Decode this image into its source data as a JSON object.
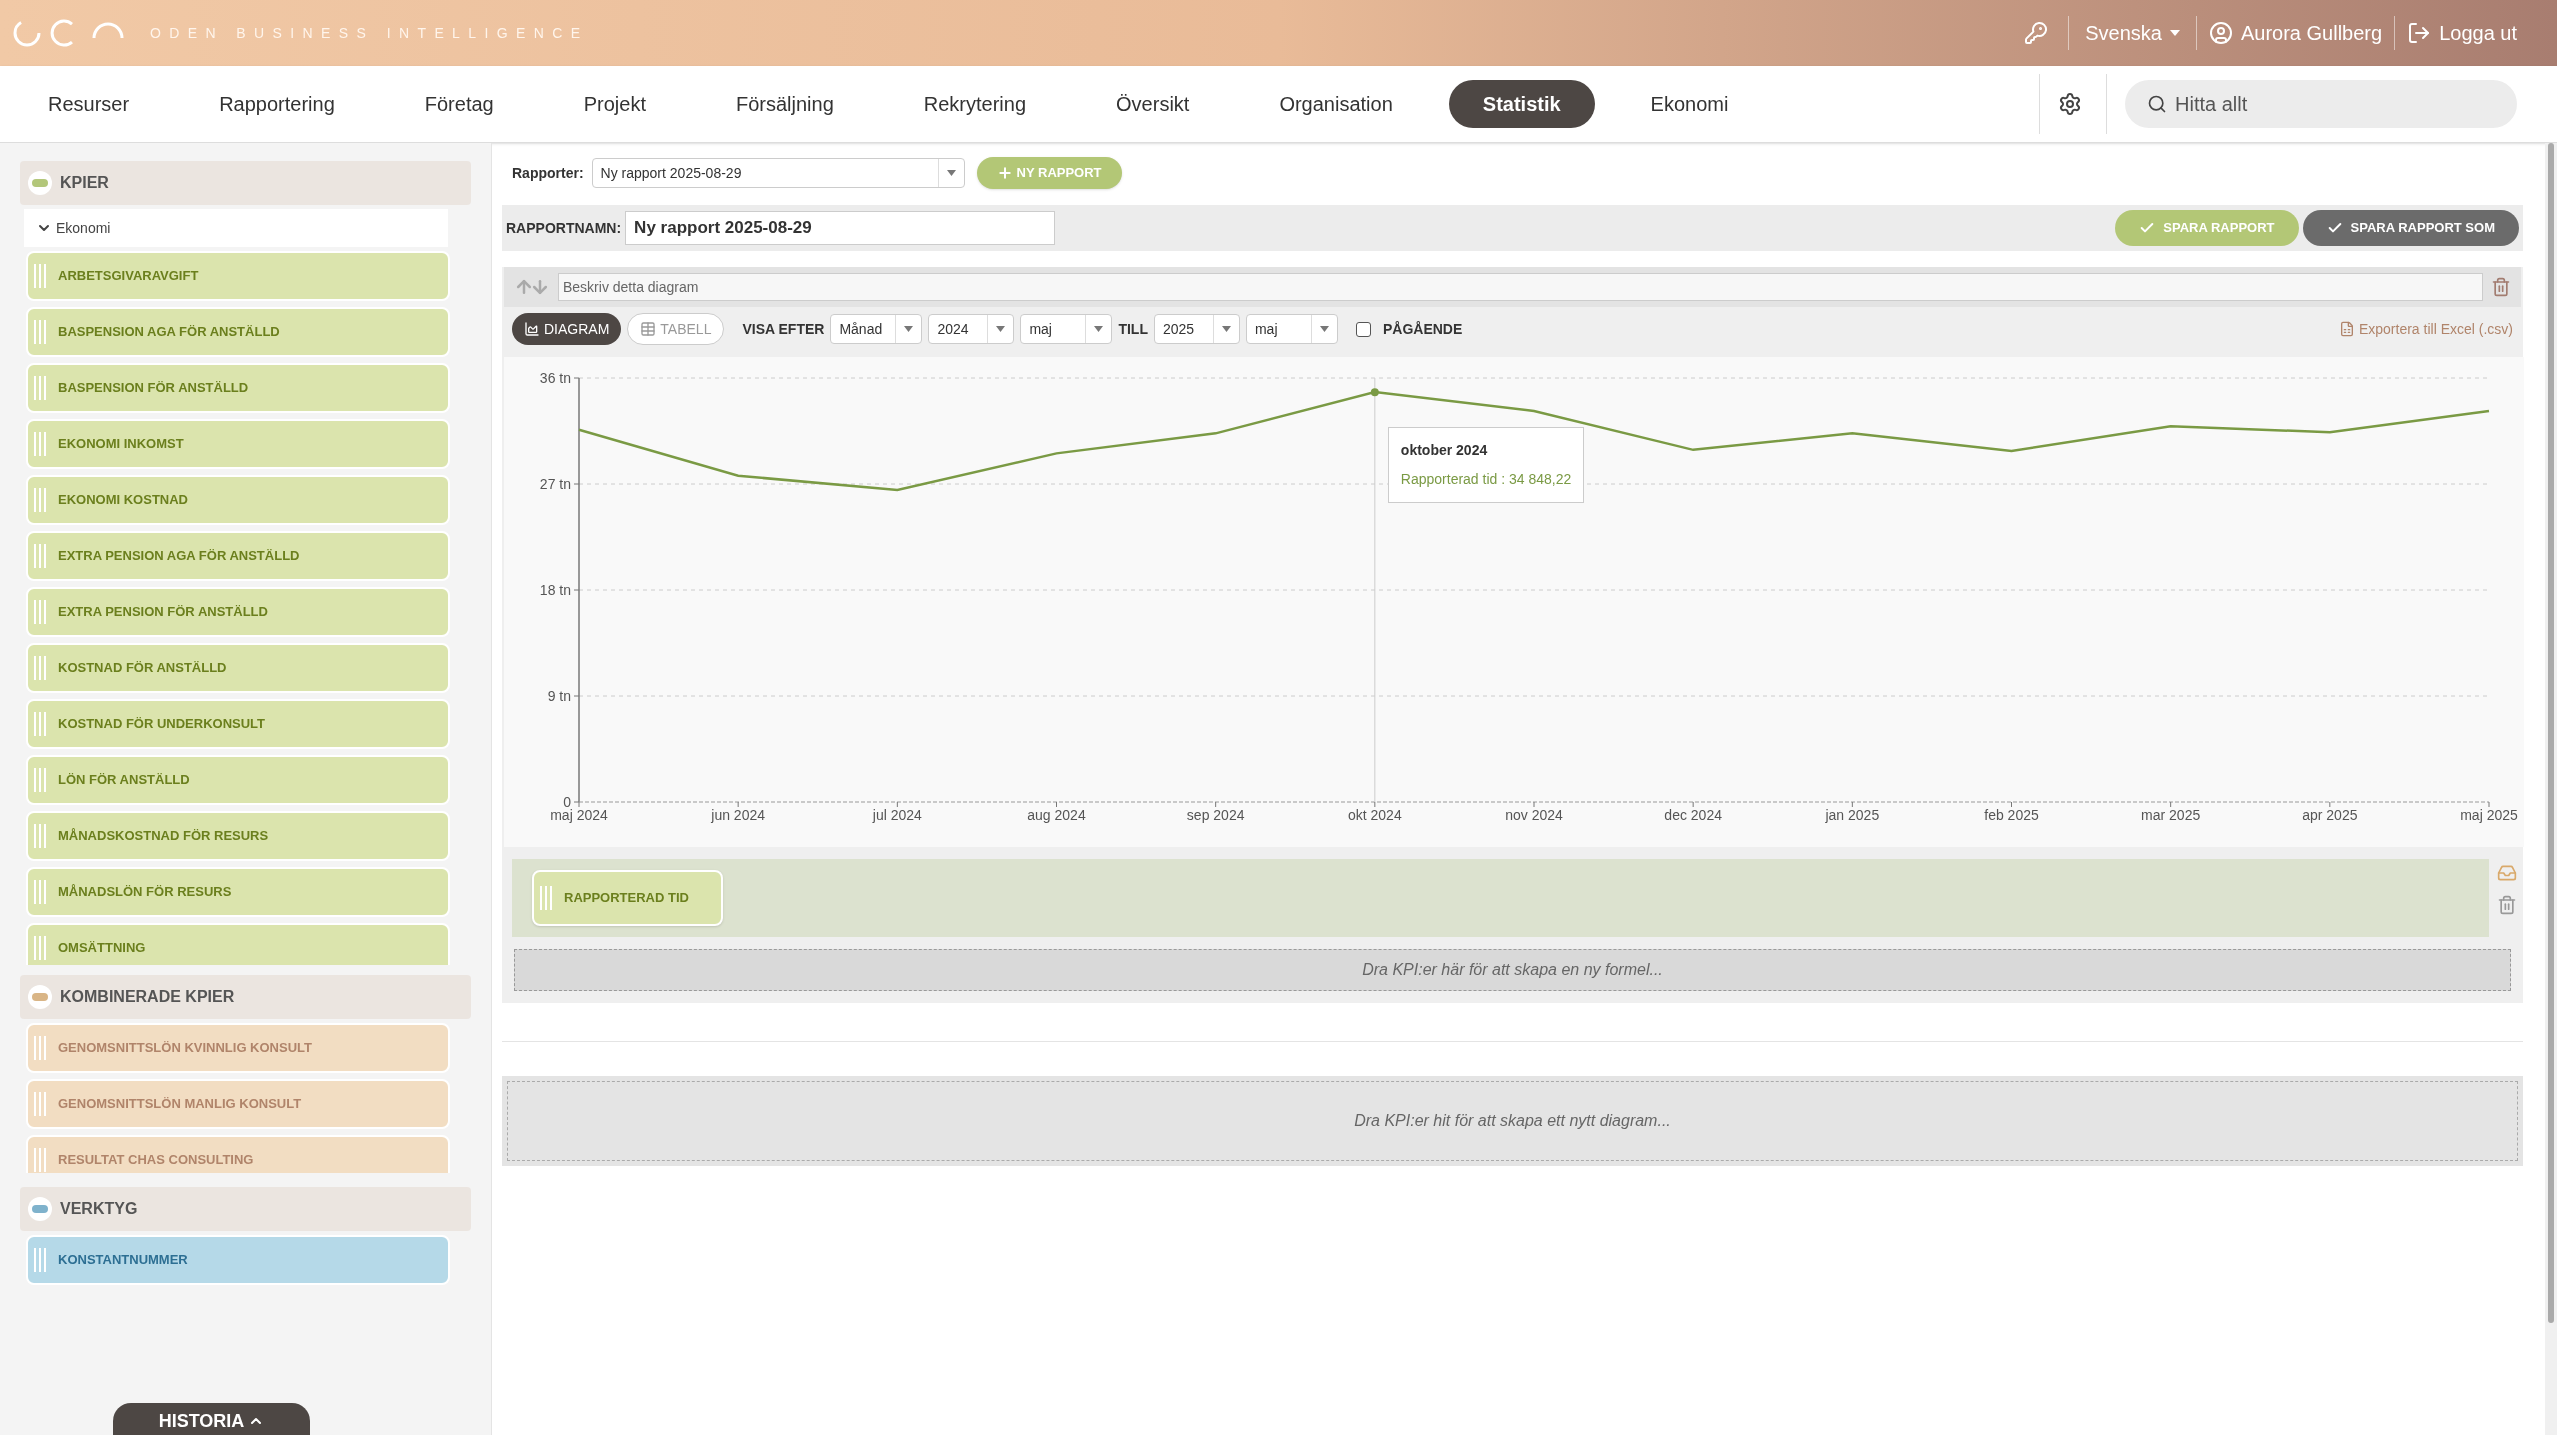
{
  "header": {
    "brand": "ODEN BUSINESS INTELLIGENCE",
    "language": "Svenska",
    "user": "Aurora Gullberg",
    "logout": "Logga ut"
  },
  "nav": {
    "items": [
      {
        "label": "Resurser",
        "selected": false
      },
      {
        "label": "Rapportering",
        "selected": false
      },
      {
        "label": "Företag",
        "selected": false
      },
      {
        "label": "Projekt",
        "selected": false
      },
      {
        "label": "Försäljning",
        "selected": false
      },
      {
        "label": "Rekrytering",
        "selected": false
      },
      {
        "label": "Översikt",
        "selected": false
      },
      {
        "label": "Organisation",
        "selected": false
      },
      {
        "label": "Statistik",
        "selected": true
      },
      {
        "label": "Ekonomi",
        "selected": false
      }
    ],
    "search": {
      "placeholder": "Hitta allt"
    }
  },
  "sidebar": {
    "sections": [
      {
        "title": "KPIER",
        "kind": "kpi",
        "group": {
          "label": "Ekonomi",
          "expanded": true
        },
        "items": [
          "ARBETSGIVARAVGIFT",
          "BASPENSION AGA FÖR ANSTÄLLD",
          "BASPENSION FÖR ANSTÄLLD",
          "EKONOMI INKOMST",
          "EKONOMI KOSTNAD",
          "EXTRA PENSION AGA FÖR ANSTÄLLD",
          "EXTRA PENSION FÖR ANSTÄLLD",
          "KOSTNAD FÖR ANSTÄLLD",
          "KOSTNAD FÖR UNDERKONSULT",
          "LÖN FÖR ANSTÄLLD",
          "MÅNADSKOSTNAD FÖR RESURS",
          "MÅNADSLÖN FÖR RESURS",
          "OMSÄTTNING"
        ]
      },
      {
        "title": "KOMBINERADE KPIER",
        "kind": "combined",
        "items": [
          "GENOMSNITTSLÖN KVINNLIG KONSULT",
          "GENOMSNITTSLÖN MANLIG KONSULT",
          "RESULTAT CHAS CONSULTING"
        ]
      },
      {
        "title": "VERKTYG",
        "kind": "tool",
        "items": [
          "KONSTANTNUMMER"
        ]
      }
    ],
    "history_button": "HISTORIA"
  },
  "toolbar": {
    "reports_label": "Rapporter:",
    "report_select": "Ny rapport 2025-08-29",
    "new_report": "NY RAPPORT",
    "name_label": "RAPPORTNAMN:",
    "name_value": "Ny rapport 2025-08-29",
    "save": "SPARA RAPPORT",
    "save_as": "SPARA RAPPORT SOM"
  },
  "diagram": {
    "description_placeholder": "Beskriv detta diagram",
    "view_tabs": [
      {
        "label": "DIAGRAM",
        "kind": "chart",
        "selected": true
      },
      {
        "label": "TABELL",
        "kind": "table",
        "selected": false
      }
    ],
    "visa_label": "VISA EFTER",
    "period_select": "Månad",
    "from_year": "2024",
    "from_month": "maj",
    "till_label": "TILL",
    "to_year": "2025",
    "to_month": "maj",
    "ongoing": {
      "label": "PÅGÅENDE",
      "checked": false
    },
    "export": "Exportera till Excel (.csv)",
    "chart_data": {
      "type": "line",
      "categories": [
        "maj 2024",
        "jun 2024",
        "jul 2024",
        "aug 2024",
        "sep 2024",
        "okt 2024",
        "nov 2024",
        "dec 2024",
        "jan 2025",
        "feb 2025",
        "mar 2025",
        "apr 2025",
        "maj 2025"
      ],
      "series": [
        {
          "name": "Rapporterad tid",
          "color": "#7a9a44",
          "values": [
            31.6,
            27.7,
            26.5,
            29.6,
            31.3,
            34.8,
            33.2,
            29.9,
            31.3,
            29.8,
            31.9,
            31.4,
            33.2
          ]
        }
      ],
      "ylim": [
        0,
        36
      ],
      "grid": true,
      "ref_lines": [
        {
          "axis": "x",
          "value": "okt 2024",
          "color": "#cccccc"
        }
      ],
      "yticks": [
        {
          "value": 0,
          "label": "0"
        },
        {
          "value": 9,
          "label": "9 tn"
        },
        {
          "value": 18,
          "label": "18 tn"
        },
        {
          "value": 27,
          "label": "27 tn"
        },
        {
          "value": 36,
          "label": "36 tn"
        }
      ]
    },
    "tooltip": {
      "title": "oktober 2024",
      "value": ": 34 848,22"
    },
    "formula": {
      "chips": [
        "RAPPORTERAD TID"
      ],
      "drop_hint": "Dra KPI:er här för att skapa en ny formel..."
    }
  },
  "new_diagram_hint": "Dra KPI:er hit för att skapa ett nytt diagram..."
}
